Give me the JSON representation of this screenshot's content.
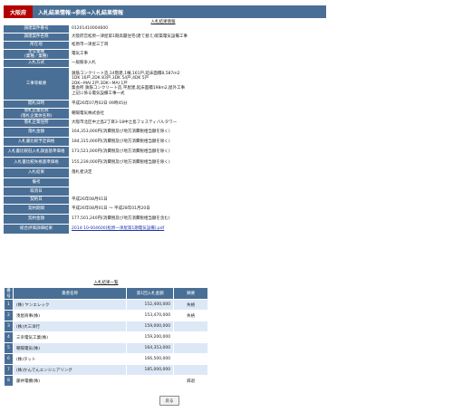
{
  "header": {
    "prefecture": "大阪府",
    "title": "入札結果情報→参照→入札結果情報"
  },
  "detail_title": "入札結果情報",
  "detail_rows": [
    {
      "label": "調達案件番号",
      "value": "01201410004600"
    },
    {
      "label": "調達案件名称",
      "value": "大阪府営松原一津屋第1期高層住宅(建て替え)新築電気設備工事"
    },
    {
      "label": "所在地",
      "value": "松原市一津屋三丁目"
    },
    {
      "label": "主な業種\n(業種／業種)",
      "value": "電気工事"
    },
    {
      "label": "入札方式",
      "value": "一般競争入札"
    },
    {
      "label": "工事等概要",
      "value": "鉄筋コンクリート造,14階建,1棟,161戸,延床面積8,587m2\n1DK 16戸,2DK 83戸,3DK 54戸,4DK 5戸\n2DK−MAI 2戸,3DK−MAI 1戸\n集会所 鉄筋コンクリート造,平屋建,延床面積198m2,屋外工事\n上記に係る電気設備工事一式"
    },
    {
      "label": "開札日時",
      "value": "平成26年07月02日 09時45分"
    },
    {
      "label": "落札企業名称\n(落札企業体名称)",
      "value": "朝陽電気株式会社"
    },
    {
      "label": "落札企業住所",
      "value": "大阪市北区中之島2丁目3-18中之島フェスティバルタワー"
    },
    {
      "label": "落札金額",
      "value": "164,353,000円(消費税及び地方消費税相当額を除く)"
    },
    {
      "label": "入札書比較予定価格",
      "value": "184,315,000円(消費税及び地方消費税相当額を除く)"
    },
    {
      "label": "入札書比較低入札調査基準価格",
      "value": "173,521,000円(消費税及び地方消費税相当額を除く)"
    },
    {
      "label": "入札書比較失格基準価格",
      "value": "155,239,000円(消費税及び地方消費税相当額を除く)"
    },
    {
      "label": "入札結果",
      "value": "落札者決定"
    },
    {
      "label": "備考",
      "value": ""
    },
    {
      "label": "取消日",
      "value": ""
    },
    {
      "label": "契約日",
      "value": "平成26年08月01日"
    },
    {
      "label": "契約期間",
      "value": "平成26年08月01日 ～ 平成28年01月20日"
    },
    {
      "label": "契約金額",
      "value": "177,501,240円(消費税及び地方消費税相当額を含む)"
    },
    {
      "label": "総合評価詳細結果",
      "value": "2014-10-004600[松原一津屋第1期電気設備].pdf"
    }
  ],
  "list_title": "入札結果一覧",
  "list_headers": [
    "番号",
    "業者名称",
    "第1回入札金額",
    "摘要"
  ],
  "list_rows": [
    {
      "no": "1",
      "name": "(株) ヤンエレック",
      "amount": "152,400,000",
      "remark": "失格"
    },
    {
      "no": "2",
      "name": "湊屋商事(株)",
      "amount": "153,470,000",
      "remark": "失格"
    },
    {
      "no": "3",
      "name": "(株)大三洋行",
      "amount": "159,000,000",
      "remark": ""
    },
    {
      "no": "4",
      "name": "三幸電気工業(株)",
      "amount": "159,200,000",
      "remark": ""
    },
    {
      "no": "5",
      "name": "朝陽電気(株)",
      "amount": "164,353,000",
      "remark": ""
    },
    {
      "no": "6",
      "name": "(株)タット",
      "amount": "166,500,000",
      "remark": ""
    },
    {
      "no": "7",
      "name": "(株)かんでんエンジニアリング",
      "amount": "185,000,000",
      "remark": ""
    },
    {
      "no": "8",
      "name": "藤井電機(株)",
      "amount": "",
      "remark": "辞退"
    }
  ],
  "back_button": "戻る",
  "colors": {
    "header_bg": "#4a6f96",
    "prefecture_bg": "#b30000",
    "row_alt": "#dde8f7"
  }
}
